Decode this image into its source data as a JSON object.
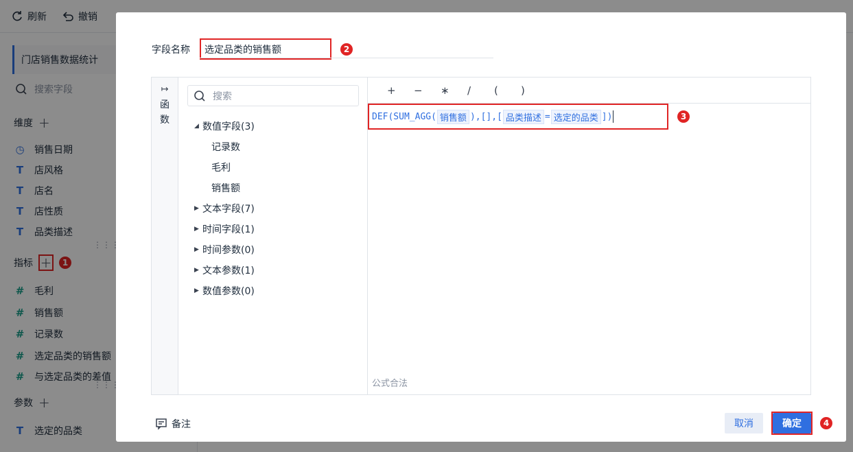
{
  "toolbar": {
    "refresh_label": "刷新",
    "undo_label": "撤销"
  },
  "sidebar": {
    "dataset_name": "门店销售数据统计",
    "search_placeholder": "搜索字段",
    "dimensions_title": "维度",
    "dimensions": [
      {
        "icon": "clock-icon",
        "label": "销售日期"
      },
      {
        "icon": "text-type-icon",
        "label": "店风格"
      },
      {
        "icon": "text-type-icon",
        "label": "店名"
      },
      {
        "icon": "text-type-icon",
        "label": "店性质"
      },
      {
        "icon": "text-type-icon",
        "label": "品类描述"
      }
    ],
    "measures_title": "指标",
    "measures": [
      {
        "icon": "number-type-icon",
        "label": "毛利"
      },
      {
        "icon": "number-type-icon",
        "label": "销售额"
      },
      {
        "icon": "number-type-icon",
        "label": "记录数"
      },
      {
        "icon": "calc-field-icon",
        "label": "选定品类的销售额"
      },
      {
        "icon": "calc-field-icon",
        "label": "与选定品类的差值"
      }
    ],
    "params_title": "参数",
    "params": [
      {
        "icon": "text-param-icon",
        "label": "选定的品类"
      }
    ]
  },
  "modal": {
    "field_name_label": "字段名称",
    "field_name_value": "选定品类的销售额",
    "functions_label": "函数",
    "tree_search_placeholder": "搜索",
    "tree": [
      {
        "label": "数值字段(3)",
        "expanded": true,
        "children": [
          "记录数",
          "毛利",
          "销售额"
        ]
      },
      {
        "label": "文本字段(7)",
        "expanded": false
      },
      {
        "label": "时间字段(1)",
        "expanded": false
      },
      {
        "label": "时间参数(0)",
        "expanded": false
      },
      {
        "label": "文本参数(1)",
        "expanded": false
      },
      {
        "label": "数值参数(0)",
        "expanded": false
      }
    ],
    "operators": [
      "+",
      "−",
      "∗",
      "/",
      "(",
      ")"
    ],
    "formula": {
      "fn": "DEF(SUM_AGG(",
      "token1": "销售额",
      "mid": "),[],[",
      "token2": "品类描述",
      "eq": "=",
      "token3": "选定的品类",
      "end": "])"
    },
    "validity_text": "公式合法",
    "note_label": "备注",
    "cancel_label": "取消",
    "ok_label": "确定"
  },
  "badges": [
    "1",
    "2",
    "3",
    "4"
  ],
  "colors": {
    "accent": "#2f6fe0",
    "highlight_red": "#e02424"
  }
}
